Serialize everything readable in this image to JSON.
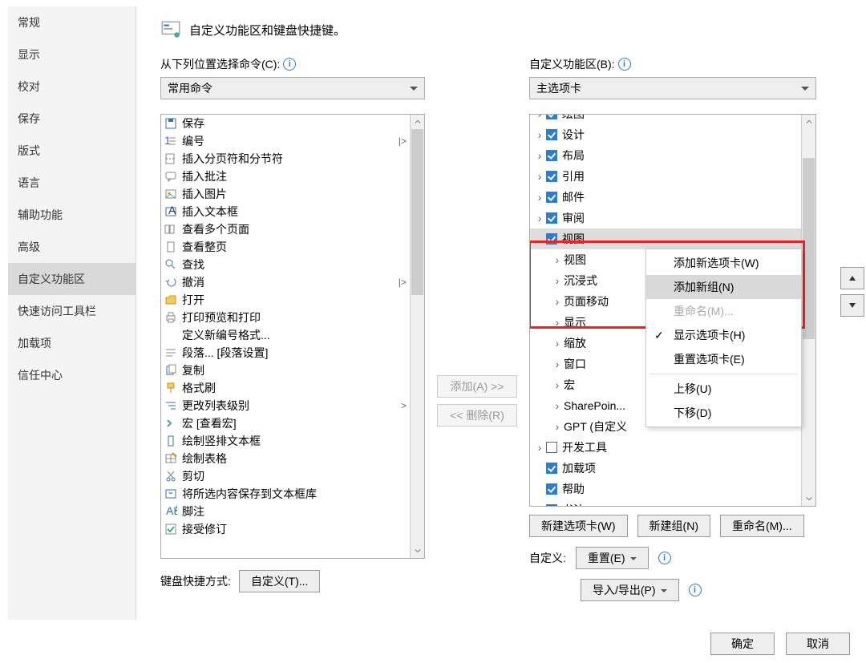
{
  "sidebar": {
    "items": [
      {
        "label": "常规"
      },
      {
        "label": "显示"
      },
      {
        "label": "校对"
      },
      {
        "label": "保存"
      },
      {
        "label": "版式"
      },
      {
        "label": "语言"
      },
      {
        "label": "辅助功能"
      },
      {
        "label": "高级"
      },
      {
        "label": "自定义功能区",
        "selected": true
      },
      {
        "label": "快速访问工具栏"
      },
      {
        "label": "加载项"
      },
      {
        "label": "信任中心"
      }
    ]
  },
  "header": {
    "title": "自定义功能区和键盘快捷键。"
  },
  "left_panel": {
    "label": "从下列位置选择命令(C):",
    "combo_value": "常用命令",
    "commands": [
      {
        "label": "保存",
        "icon": "save"
      },
      {
        "label": "编号",
        "icon": "numbering",
        "ext": "|>"
      },
      {
        "label": "插入分页符和分节符",
        "icon": "break"
      },
      {
        "label": "插入批注",
        "icon": "comment"
      },
      {
        "label": "插入图片",
        "icon": "picture"
      },
      {
        "label": "插入文本框",
        "icon": "textbox"
      },
      {
        "label": "查看多个页面",
        "icon": "multipage"
      },
      {
        "label": "查看整页",
        "icon": "onepage"
      },
      {
        "label": "查找",
        "icon": "find"
      },
      {
        "label": "撤消",
        "icon": "undo",
        "ext": "|>"
      },
      {
        "label": "打开",
        "icon": "open"
      },
      {
        "label": "打印预览和打印",
        "icon": "print"
      },
      {
        "label": "定义新编号格式...",
        "icon": "blank"
      },
      {
        "label": "段落... [段落设置]",
        "icon": "para"
      },
      {
        "label": "复制",
        "icon": "copy"
      },
      {
        "label": "格式刷",
        "icon": "fmtpaint"
      },
      {
        "label": "更改列表级别",
        "icon": "listlevel",
        "ext": ">"
      },
      {
        "label": "宏 [查看宏]",
        "icon": "macro"
      },
      {
        "label": "绘制竖排文本框",
        "icon": "vtextbox"
      },
      {
        "label": "绘制表格",
        "icon": "drawtable"
      },
      {
        "label": "剪切",
        "icon": "cut"
      },
      {
        "label": "将所选内容保存到文本框库",
        "icon": "savebox"
      },
      {
        "label": "脚注",
        "icon": "footnote"
      },
      {
        "label": "接受修订",
        "icon": "accept"
      }
    ]
  },
  "mid": {
    "add": "添加(A) >>",
    "remove": "<< 删除(R)"
  },
  "right_panel": {
    "label": "自定义功能区(B):",
    "combo_value": "主选项卡",
    "tree": [
      {
        "label": "绘图",
        "chk": true,
        "lvl": 0,
        "caret": ">",
        "cut": true
      },
      {
        "label": "设计",
        "chk": true,
        "lvl": 0,
        "caret": ">"
      },
      {
        "label": "布局",
        "chk": true,
        "lvl": 0,
        "caret": ">"
      },
      {
        "label": "引用",
        "chk": true,
        "lvl": 0,
        "caret": ">"
      },
      {
        "label": "邮件",
        "chk": true,
        "lvl": 0,
        "caret": ">"
      },
      {
        "label": "审阅",
        "chk": true,
        "lvl": 0,
        "caret": ">"
      },
      {
        "label": "视图",
        "chk": true,
        "lvl": 0,
        "caret": "v",
        "sel": true
      },
      {
        "label": "视图",
        "lvl": 1,
        "caret": ">"
      },
      {
        "label": "沉浸式",
        "lvl": 1,
        "caret": ">"
      },
      {
        "label": "页面移动",
        "lvl": 1,
        "caret": ">"
      },
      {
        "label": "显示",
        "lvl": 1,
        "caret": ">"
      },
      {
        "label": "缩放",
        "lvl": 1,
        "caret": ">"
      },
      {
        "label": "窗口",
        "lvl": 1,
        "caret": ">"
      },
      {
        "label": "宏",
        "lvl": 1,
        "caret": ">"
      },
      {
        "label": "SharePoin...",
        "lvl": 1,
        "caret": ">"
      },
      {
        "label": "GPT (自定义",
        "lvl": 1,
        "caret": ">"
      },
      {
        "label": "开发工具",
        "chk": false,
        "lvl": 0,
        "caret": ">"
      },
      {
        "label": "加载项",
        "chk": true,
        "lvl": 0
      },
      {
        "label": "帮助",
        "chk": true,
        "lvl": 0
      },
      {
        "label": "书法",
        "chk": true,
        "lvl": 0
      }
    ],
    "buttons": {
      "newtab": "新建选项卡(W)",
      "newgroup": "新建组(N)",
      "rename": "重命名(M)..."
    },
    "reset_label": "自定义:",
    "reset_btn": "重置(E)",
    "import_btn": "导入/导出(P)"
  },
  "context_menu": {
    "items": [
      {
        "label": "添加新选项卡(W)"
      },
      {
        "label": "添加新组(N)",
        "sel": true
      },
      {
        "label": "重命名(M)...",
        "dis": true
      },
      {
        "label": "显示选项卡(H)",
        "check": true
      },
      {
        "label": "重置选项卡(E)"
      },
      {
        "sep": true
      },
      {
        "label": "上移(U)"
      },
      {
        "label": "下移(D)"
      }
    ]
  },
  "keyboard": {
    "label": "键盘快捷方式:",
    "btn": "自定义(T)..."
  },
  "footer": {
    "ok": "确定",
    "cancel": "取消"
  }
}
